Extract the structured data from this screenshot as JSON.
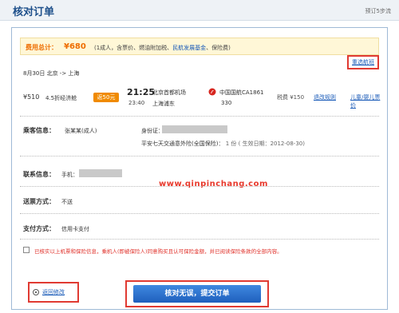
{
  "page": {
    "title": "核对订单",
    "steps_hint": "预订5步流"
  },
  "total": {
    "label": "费用总计：",
    "amount": "¥680",
    "detail_prefix": "(1成人，含票价、燃油附加税、",
    "detail_link": "民航发展基金",
    "detail_suffix": "、保险费)"
  },
  "flight": {
    "route": "8月30日 北京 -> 上海",
    "reselect_label": "重选航班",
    "price": "¥510",
    "discount": "4.5折经济舱",
    "badge": "返50元",
    "dep_time": "21:25",
    "arr_time": "23:40",
    "dep_airport": "北京首都机场",
    "arr_airport": "上海浦东",
    "airline": "中国国航CA1861",
    "flight_no": "330",
    "tax": "税费 ¥150",
    "rules_link": "退改规则",
    "child_link": "儿童/婴儿票价"
  },
  "passenger": {
    "label": "乘客信息：",
    "name": "张某某(成人)",
    "id_label": "身份证：",
    "insurance_main": "平安七天交通意外险(全国保险)：",
    "insurance_detail": "1 份 ( 生效日期：2012-08-30)"
  },
  "watermark": "www.qinpinchang.com",
  "contact": {
    "label": "联系信息：",
    "phone_label": "手机："
  },
  "delivery": {
    "label": "送票方式：",
    "value": "不送"
  },
  "payment": {
    "label": "支付方式：",
    "value": "信用卡支付"
  },
  "agreement": {
    "text": "已核实以上机票和保险信息，乘机人(即被保险人)同意购买且认可保险金额，并已阅读保险条款的全部内容。"
  },
  "actions": {
    "back_label": "返回修改",
    "submit_label": "核对无误，提交订单"
  },
  "colors": {
    "accent_orange": "#ee6d00",
    "link_blue": "#1a5bb8",
    "highlight_red": "#e03a32",
    "title_blue": "#1d4f8a"
  }
}
